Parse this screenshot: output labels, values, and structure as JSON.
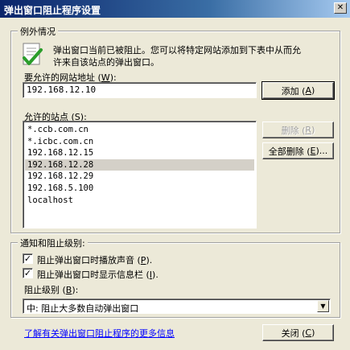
{
  "window": {
    "title": "弹出窗口阻止程序设置",
    "close_glyph": "✕"
  },
  "exceptions": {
    "group_label": "例外情况",
    "info_line1": "弹出窗口当前已被阻止。您可以将特定网站添加到下表中从而允",
    "info_line2": "许来自该站点的弹出窗口。",
    "address_label_pre": "要允许的网站地址 (",
    "address_label_key": "W",
    "address_label_post": "):",
    "address_value": "192.168.12.10",
    "add_button_pre": "添加 (",
    "add_button_key": "A",
    "add_button_post": ")",
    "allowed_label_pre": "允许的站点 (",
    "allowed_label_key": "S",
    "allowed_label_post": "):",
    "allowed_sites": [
      "*.ccb.com.cn",
      "*.icbc.com.cn",
      "192.168.12.15",
      "192.168.12.28",
      "192.168.12.29",
      "192.168.5.100",
      "localhost"
    ],
    "selected_site": "192.168.12.28",
    "remove_button_pre": "删除 (",
    "remove_button_key": "R",
    "remove_button_post": ")",
    "remove_all_button_pre": "全部删除 (",
    "remove_all_button_key": "E",
    "remove_all_button_post": ")..."
  },
  "notifications": {
    "group_label": "通知和阻止级别:",
    "sound_label_pre": "阻止弹出窗口时播放声音 (",
    "sound_label_key": "P",
    "sound_label_post": ").",
    "sound_checked": true,
    "infobar_label_pre": "阻止弹出窗口时显示信息栏 (",
    "infobar_label_key": "I",
    "infobar_label_post": ").",
    "infobar_checked": true,
    "level_label_pre": "阻止级别 (",
    "level_label_key": "B",
    "level_label_post": "):",
    "level_value": "中: 阻止大多数自动弹出窗口"
  },
  "footer": {
    "learn_more_link": "了解有关弹出窗口阻止程序的更多信息",
    "close_button_pre": "关闭 (",
    "close_button_key": "C",
    "close_button_post": ")"
  },
  "colors": {
    "dialog_bg": "#ece9d8",
    "title_start": "#0a246a",
    "title_end": "#a6caf0",
    "link": "#0000ff",
    "selection": "#d4d0c8"
  },
  "icons": {
    "info_icon": "document-checkmark-icon",
    "dropdown_icon": "chevron-down-icon"
  }
}
